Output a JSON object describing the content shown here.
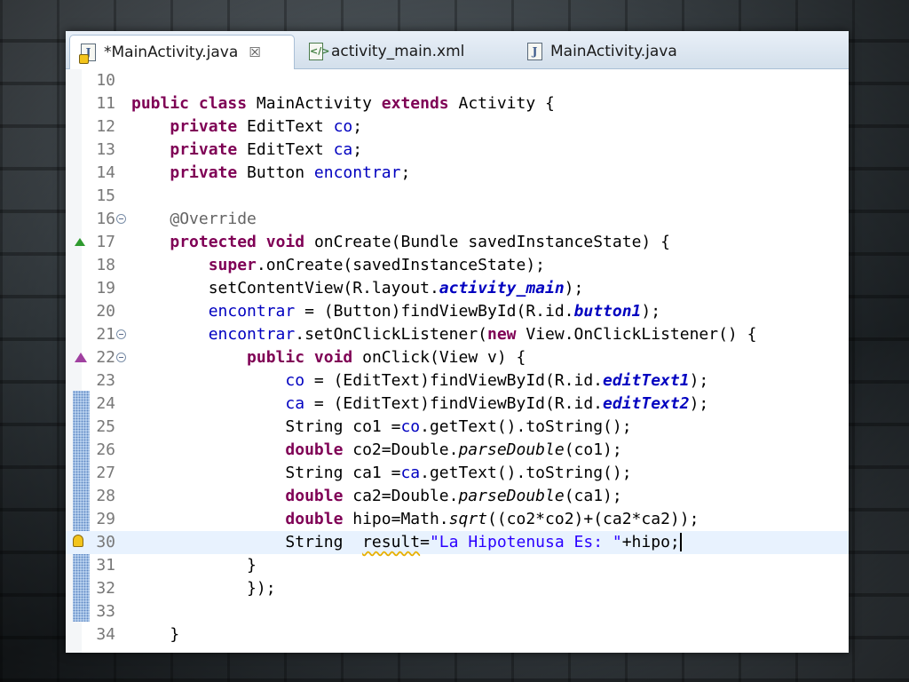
{
  "tabs": [
    {
      "label": "*MainActivity.java",
      "icon": "java-file-icon",
      "active": true,
      "has_warning": true,
      "closable": true
    },
    {
      "label": "activity_main.xml",
      "icon": "xml-file-icon",
      "active": false
    },
    {
      "label": "MainActivity.java",
      "icon": "java-file-icon",
      "active": false
    }
  ],
  "editor": {
    "current_line": 30,
    "lines": [
      {
        "n": "10",
        "tokens": []
      },
      {
        "n": "11",
        "tokens": [
          [
            "kw",
            "public"
          ],
          [
            "p",
            " "
          ],
          [
            "kw",
            "class"
          ],
          [
            "p",
            " MainActivity "
          ],
          [
            "kw",
            "extends"
          ],
          [
            "p",
            " Activity {"
          ]
        ]
      },
      {
        "n": "12",
        "tokens": [
          [
            "p",
            "    "
          ],
          [
            "kw",
            "private"
          ],
          [
            "p",
            " EditText "
          ],
          [
            "fld",
            "co"
          ],
          [
            "p",
            ";"
          ]
        ]
      },
      {
        "n": "13",
        "tokens": [
          [
            "p",
            "    "
          ],
          [
            "kw",
            "private"
          ],
          [
            "p",
            " EditText "
          ],
          [
            "fld",
            "ca"
          ],
          [
            "p",
            ";"
          ]
        ]
      },
      {
        "n": "14",
        "tokens": [
          [
            "p",
            "    "
          ],
          [
            "kw",
            "private"
          ],
          [
            "p",
            " Button "
          ],
          [
            "fld",
            "encontrar"
          ],
          [
            "p",
            ";"
          ]
        ]
      },
      {
        "n": "15",
        "tokens": []
      },
      {
        "n": "16",
        "fold": true,
        "tokens": [
          [
            "p",
            "    "
          ],
          [
            "ann",
            "@Override"
          ]
        ]
      },
      {
        "n": "17",
        "marker": "override",
        "tokens": [
          [
            "p",
            "    "
          ],
          [
            "kw",
            "protected"
          ],
          [
            "p",
            " "
          ],
          [
            "kw",
            "void"
          ],
          [
            "p",
            " onCreate(Bundle savedInstanceState) {"
          ]
        ]
      },
      {
        "n": "18",
        "tokens": [
          [
            "p",
            "        "
          ],
          [
            "kw",
            "super"
          ],
          [
            "p",
            ".onCreate(savedInstanceState);"
          ]
        ]
      },
      {
        "n": "19",
        "tokens": [
          [
            "p",
            "        setContentView(R.layout."
          ],
          [
            "sfld",
            "activity_main"
          ],
          [
            "p",
            ");"
          ]
        ]
      },
      {
        "n": "20",
        "tokens": [
          [
            "p",
            "        "
          ],
          [
            "fld",
            "encontrar"
          ],
          [
            "p",
            " = (Button)findViewById(R.id."
          ],
          [
            "sfld",
            "button1"
          ],
          [
            "p",
            ");"
          ]
        ]
      },
      {
        "n": "21",
        "fold": true,
        "tokens": [
          [
            "p",
            "        "
          ],
          [
            "fld",
            "encontrar"
          ],
          [
            "p",
            ".setOnClickListener("
          ],
          [
            "kw",
            "new"
          ],
          [
            "p",
            " View.OnClickListener() {"
          ]
        ]
      },
      {
        "n": "22",
        "fold": true,
        "marker": "implement",
        "tokens": [
          [
            "p",
            "            "
          ],
          [
            "kw",
            "public"
          ],
          [
            "p",
            " "
          ],
          [
            "kw",
            "void"
          ],
          [
            "p",
            " onClick(View v) {"
          ]
        ]
      },
      {
        "n": "23",
        "tokens": [
          [
            "p",
            "                "
          ],
          [
            "fld",
            "co"
          ],
          [
            "p",
            " = (EditText)findViewById(R.id."
          ],
          [
            "sfld",
            "editText1"
          ],
          [
            "p",
            ");"
          ]
        ]
      },
      {
        "n": "24",
        "tokens": [
          [
            "p",
            "                "
          ],
          [
            "fld",
            "ca"
          ],
          [
            "p",
            " = (EditText)findViewById(R.id."
          ],
          [
            "sfld",
            "editText2"
          ],
          [
            "p",
            ");"
          ]
        ]
      },
      {
        "n": "25",
        "tokens": [
          [
            "p",
            "                String co1 ="
          ],
          [
            "fld",
            "co"
          ],
          [
            "p",
            ".getText().toString();"
          ]
        ]
      },
      {
        "n": "26",
        "tokens": [
          [
            "p",
            "                "
          ],
          [
            "kw",
            "double"
          ],
          [
            "p",
            " co2=Double."
          ],
          [
            "smeth",
            "parseDouble"
          ],
          [
            "p",
            "(co1);"
          ]
        ]
      },
      {
        "n": "27",
        "tokens": [
          [
            "p",
            "                String ca1 ="
          ],
          [
            "fld",
            "ca"
          ],
          [
            "p",
            ".getText().toString();"
          ]
        ]
      },
      {
        "n": "28",
        "tokens": [
          [
            "p",
            "                "
          ],
          [
            "kw",
            "double"
          ],
          [
            "p",
            " ca2=Double."
          ],
          [
            "smeth",
            "parseDouble"
          ],
          [
            "p",
            "(ca1);"
          ]
        ]
      },
      {
        "n": "29",
        "tokens": [
          [
            "p",
            "                "
          ],
          [
            "kw",
            "double"
          ],
          [
            "p",
            " hipo=Math."
          ],
          [
            "smeth",
            "sqrt"
          ],
          [
            "p",
            "((co2*co2)+(ca2*ca2));"
          ]
        ]
      },
      {
        "n": "30",
        "marker": "warning",
        "tokens": [
          [
            "p",
            "                String  "
          ],
          [
            "warnvar",
            "result"
          ],
          [
            "p",
            "="
          ],
          [
            "str",
            "\"La Hipotenusa Es: \""
          ],
          [
            "p",
            "+hipo;"
          ],
          [
            "caret",
            ""
          ]
        ]
      },
      {
        "n": "31",
        "tokens": [
          [
            "p",
            "            }"
          ]
        ]
      },
      {
        "n": "32",
        "tokens": [
          [
            "p",
            "            });"
          ]
        ]
      },
      {
        "n": "33",
        "tokens": []
      },
      {
        "n": "34",
        "tokens": [
          [
            "p",
            "    }"
          ]
        ]
      }
    ]
  }
}
